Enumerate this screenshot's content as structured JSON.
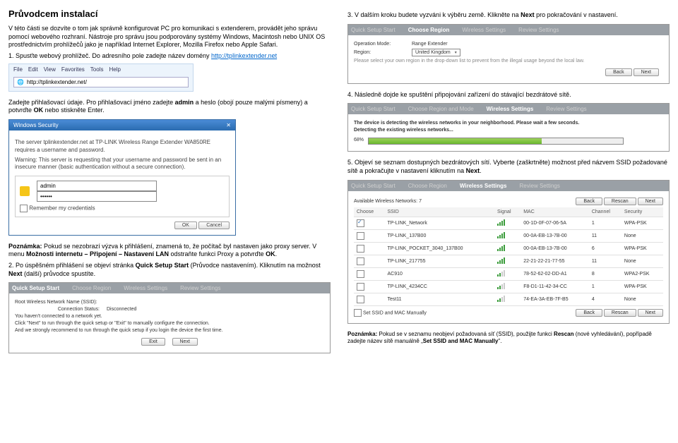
{
  "left": {
    "title": "Průvodcem instalací",
    "p1": "V této části se dozvíte o tom jak správně konfigurovat PC pro komunikaci s extenderem, provádět jeho správu pomocí webového rozhraní. Nástroje pro správu jsou podporovány systémy Windows, Macintosh nebo UNIX OS prostřednictvím prohlížečů jako je například Internet Explorer, Mozilla Firefox nebo Apple Safari.",
    "step1_prefix": "1. Spusťte webový prohlížeč. Do adresního pole zadejte název domény ",
    "step1_link": "http://tplinkextender.net",
    "browser": {
      "menu": [
        "File",
        "Edit",
        "View",
        "Favorites",
        "Tools",
        "Help"
      ],
      "url": "http://tplinkextender.net/"
    },
    "p2a": "Zadejte přihlašovací údaje. Pro přihlašovací jméno zadejte ",
    "p2a_admin": "admin",
    "p2b": " a heslo (obojí pouze malými písmeny) a potvrďte ",
    "p2b_ok": "OK",
    "p2c": " nebo stiskněte Enter.",
    "winsec": {
      "title": "Windows Security",
      "msg1": "The server tplinkextender.net at TP-LINK Wireless Range Extender WA850RE requires a username and password.",
      "msg2": "Warning: This server is requesting that your username and password be sent in an insecure manner (basic authentication without a secure connection).",
      "user": "admin",
      "remember": "Remember my credentials",
      "ok": "OK",
      "cancel": "Cancel"
    },
    "note_label": "Poznámka:",
    "note1": " Pokud se nezobrazí výzva k přihlášení, znamená to, že počítač byl nastaven jako proxy server. V menu ",
    "note1_path": "Možnosti internetu – Připojení – Nastavení LAN",
    "note1_end": " odstraňte funkci Proxy a potvrďte ",
    "note1_ok": "OK",
    "step2a": "2. Po úspěšném přihlášení se objeví stránka ",
    "step2b": "Quick Setup Start",
    "step2c": " (Průvodce nastavením). Kliknutím na možnost ",
    "step2d": "Next",
    "step2e": " (další) průvodce spustíte.",
    "qss": {
      "tabs": [
        "Quick Setup Start",
        "Choose Region",
        "Wireless Settings",
        "Review Settings"
      ],
      "ssid_label": "Root Wireless Network Name (SSID):",
      "conn_label": "Connection Status:",
      "conn_value": "Disconnected",
      "help1": "You haven't connected to a network yet.",
      "help2": "Click \"Next\" to run through the quick setup or \"Exit\" to manually configure the connection.",
      "help3": "And we strongly recommend to run through the quick setup if you login the device the first time.",
      "exit": "Exit",
      "next": "Next"
    }
  },
  "right": {
    "step3a": "3. V dalším kroku budete vyzváni k výběru země. Klikněte na ",
    "step3_next": "Next",
    "step3b": " pro pokračování v nastavení.",
    "region_tabs": [
      "Quick Setup Start",
      "Choose Region",
      "Wireless Settings",
      "Review Settings"
    ],
    "region": {
      "oper_label": "Operation Mode:",
      "oper_value": "Range Extender",
      "region_label": "Region:",
      "region_value": "United Kingdom",
      "hint": "Please select your own region in the drop-down list to prevent from the illegal usage beyond the local law.",
      "back": "Back",
      "next": "Next"
    },
    "step4": "4. Následně dojde ke spuštění připojování zařízení do stávající bezdrátové sítě.",
    "detect": {
      "tabs": [
        "Quick Setup Start",
        "Choose Region and Mode",
        "Wireless Settings",
        "Review Settings"
      ],
      "msg": "The device is detecting the wireless networks in your neighborhood. Please wait a few seconds.",
      "msg2": "Detecting the existing wireless networks...",
      "pct": "68%",
      "pct_num": 68
    },
    "step5a": "5. Objeví se seznam dostupných bezdrátových sítí. Vyberte (zaškrtněte) možnost před názvem SSID požadované sítě a pokračujte v nastavení kliknutím na ",
    "step5_next": "Next",
    "step5b": ".",
    "netlist": {
      "tabs": [
        "Quick Setup Start",
        "Choose Region",
        "Wireless Settings",
        "Review Settings"
      ],
      "avail": "Available Wireless Networks: 7",
      "back": "Back",
      "rescan": "Rescan",
      "next": "Next",
      "headers": [
        "Choose",
        "SSID",
        "Signal",
        "MAC",
        "Channel",
        "Security"
      ],
      "rows": [
        {
          "checked": true,
          "ssid": "TP-LINK_Network",
          "sig": "full",
          "mac": "00-1D-0F-07-06-5A",
          "ch": "1",
          "sec": "WPA-PSK"
        },
        {
          "checked": false,
          "ssid": "TP-LINK_137B00",
          "sig": "full",
          "mac": "00-0A-EB-13-7B-00",
          "ch": "11",
          "sec": "None"
        },
        {
          "checked": false,
          "ssid": "TP-LINK_POCKET_3040_137B00",
          "sig": "full",
          "mac": "00-0A-EB-13-7B-00",
          "ch": "6",
          "sec": "WPA-PSK"
        },
        {
          "checked": false,
          "ssid": "TP-LINK_217755",
          "sig": "full",
          "mac": "22-21-22-21-77-55",
          "ch": "11",
          "sec": "None"
        },
        {
          "checked": false,
          "ssid": "AC910",
          "sig": "low",
          "mac": "78-52-62-02-DD-A1",
          "ch": "8",
          "sec": "WPA2-PSK"
        },
        {
          "checked": false,
          "ssid": "TP-LINK_4234CC",
          "sig": "low",
          "mac": "F8-D1-11-42-34-CC",
          "ch": "1",
          "sec": "WPA-PSK"
        },
        {
          "checked": false,
          "ssid": "Test11",
          "sig": "low",
          "mac": "74-EA-3A-EB-7F-B5",
          "ch": "4",
          "sec": "None"
        }
      ],
      "manual": "Set SSID and MAC Manually"
    },
    "note_label": "Poznámka:",
    "note2a": " Pokud se v seznamu neobjeví požadovaná síť (SSID), použijte funkci ",
    "note2_rescan": "Rescan",
    "note2b": " (nové vyhledávání), popřípadě zadejte název sítě manuálně „",
    "note2_manual": "Set SSID and MAC Manually",
    "note2c": "\"."
  }
}
